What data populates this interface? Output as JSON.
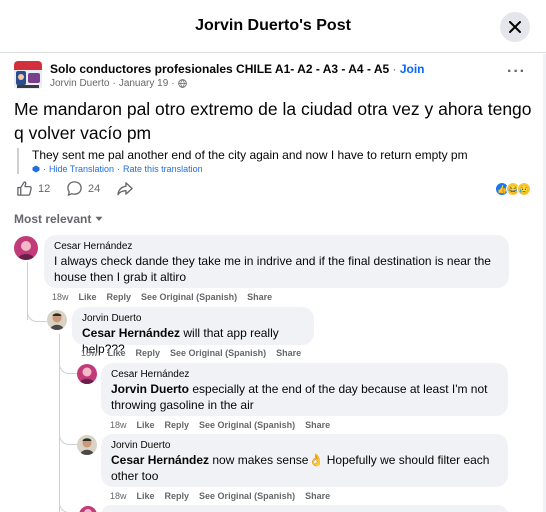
{
  "modal": {
    "title": "Jorvin Duerto's Post"
  },
  "post": {
    "group_name": "Solo conductores profesionales CHILE A1- A2 - A3 - A4 - A5",
    "join_label": "Join",
    "author": "Jorvin Duerto",
    "date": "January 19",
    "text": "Me mandaron pal otro extremo de la ciudad otra vez y ahora tengo q volver vacío pm",
    "translation": "They sent me pal another end of the city again and now I have to return empty pm",
    "hide_translation": "Hide Translation",
    "rate_translation": "Rate this translation",
    "like_count": "12",
    "comment_count": "24"
  },
  "sort_label": "Most relevant",
  "comments": [
    {
      "author": "Cesar Hernández",
      "text": "I always check dande they take me in indrive and if the final destination is near the house then I grab it altiro",
      "time": "18w",
      "like": "Like",
      "reply": "Reply",
      "see_original": "See Original (Spanish)",
      "share": "Share"
    },
    {
      "author": "Jorvin Duerto",
      "mention": "Cesar Hernández",
      "text": " will that app really help???",
      "time": "18w",
      "like": "Like",
      "reply": "Reply",
      "see_original": "See Original (Spanish)",
      "share": "Share"
    },
    {
      "author": "Cesar Hernández",
      "mention": "Jorvin Duerto",
      "text": " especially at the end of the day because at least I'm not throwing gasoline in the air",
      "time": "18w",
      "like": "Like",
      "reply": "Reply",
      "see_original": "See Original (Spanish)",
      "share": "Share"
    },
    {
      "author": "Jorvin Duerto",
      "mention": "Cesar Hernández",
      "text": " now makes sense",
      "emoji": "👌",
      "text_after": " Hopefully we should filter each other too",
      "time": "18w",
      "like": "Like",
      "reply": "Reply",
      "see_original": "See Original (Spanish)",
      "share": "Share"
    }
  ],
  "colors": {
    "accent": "#0866ff",
    "link": "#216fdb",
    "bubble": "#f0f2f5",
    "muted": "#65676b"
  },
  "icons": [
    "close-icon",
    "globe-icon",
    "more-icon",
    "like-icon",
    "comment-icon",
    "share-icon",
    "chevron-down-icon",
    "translate-icon"
  ]
}
